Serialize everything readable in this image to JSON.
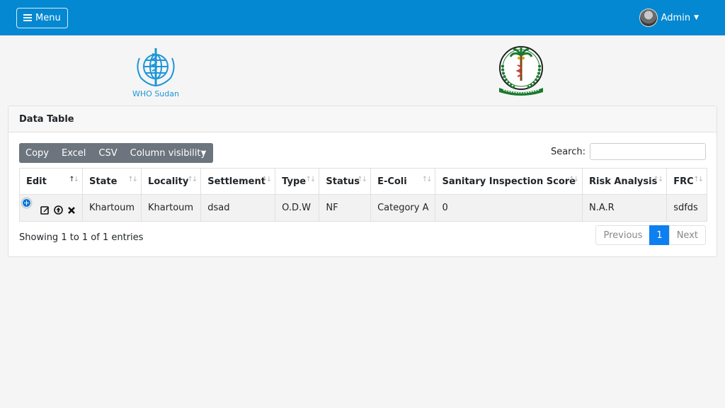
{
  "navbar": {
    "menu_label": "Menu",
    "user_label": "Admin"
  },
  "logos": {
    "who_text": "WHO Sudan"
  },
  "card": {
    "title": "Data Table"
  },
  "buttons": {
    "copy": "Copy",
    "excel": "Excel",
    "csv": "CSV",
    "column_visibility": "Column visibility"
  },
  "search": {
    "label": "Search:",
    "value": ""
  },
  "table": {
    "headers": [
      "Edit",
      "State",
      "Locality",
      "Settlement",
      "Type",
      "Status",
      "E-Coli",
      "Sanitary Inspection Score",
      "Risk Analysis",
      "FRC"
    ],
    "rows": [
      [
        "",
        "Khartoum",
        "Khartoum",
        "dsad",
        "O.D.W",
        "NF",
        "Category A",
        "0",
        "N.A.R",
        "sdfds"
      ]
    ]
  },
  "info": "Showing 1 to 1 of 1 entries",
  "pagination": {
    "previous": "Previous",
    "current": "1",
    "next": "Next"
  },
  "colors": {
    "navbar": "#0488d1",
    "primary": "#0d7ff0",
    "buttons": "#6c757d"
  }
}
